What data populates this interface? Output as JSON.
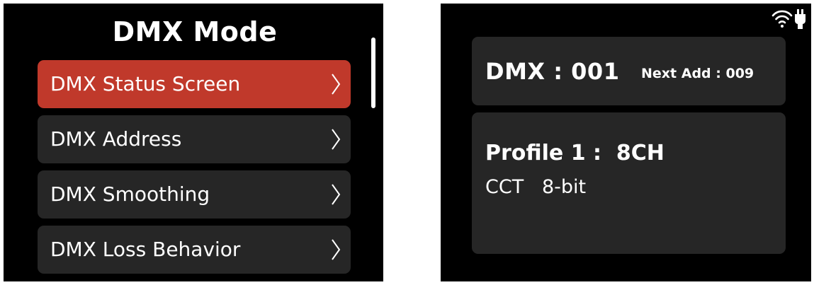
{
  "left_screen": {
    "title": "DMX Mode",
    "menu_items": [
      {
        "label": "DMX Status Screen",
        "selected": true
      },
      {
        "label": "DMX Address",
        "selected": false
      },
      {
        "label": "DMX Smoothing",
        "selected": false
      },
      {
        "label": "DMX Loss Behavior",
        "selected": false
      }
    ]
  },
  "right_screen": {
    "dmx_address": "DMX : 001",
    "next_address": "Next Add : 009",
    "profile": "Profile 1 :  8CH",
    "mode": "CCT   8-bit",
    "status_icons": [
      "wifi-icon",
      "power-plug-icon"
    ]
  },
  "colors": {
    "screen_bg": "#000000",
    "item_bg": "#262626",
    "selected_bg": "#c0392b",
    "text": "#ffffff"
  }
}
